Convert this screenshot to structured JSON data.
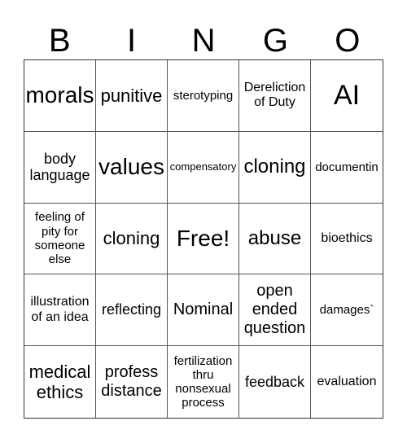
{
  "header": {
    "letters": [
      "B",
      "I",
      "N",
      "G",
      "O"
    ]
  },
  "cells": [
    "morals",
    "punitive",
    "sterotyping",
    "Dereliction of Duty",
    "AI",
    "body language",
    "values",
    "compensatory",
    "cloning",
    "documentin",
    "feeling of pity for someone else",
    "cloning",
    "Free!",
    "abuse",
    "bioethics",
    "illustration of an idea",
    "reflecting",
    "Nominal",
    "open ended question",
    "damages`",
    "medical ethics",
    "profess distance",
    "fertilization thru nonsexual process",
    "feedback",
    "evaluation"
  ]
}
